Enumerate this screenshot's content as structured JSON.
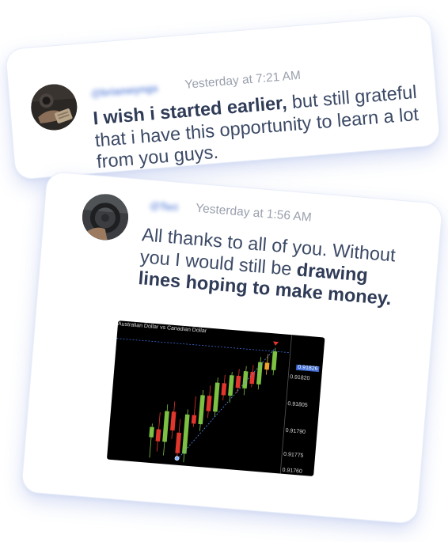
{
  "review1": {
    "username": "@brianwyngs",
    "timestamp": "Yesterday at 7:21 AM",
    "message_bold": "I wish i started earlier,",
    "message_rest": " but still grateful that i have this opportunity to learn a lot from you guys."
  },
  "review2": {
    "username": "@Teri",
    "timestamp": "Yesterday at 1:56 AM",
    "message_plain": "All thanks to all of you. Without you I would still be ",
    "message_bold": "drawing lines hoping to make money."
  },
  "chart_screenshot": {
    "title": "Australian Dollar vs Canadian Dollar",
    "current_price": "0.91826",
    "price_ticks": [
      "0.91820",
      "0.91805",
      "0.91790",
      "0.91775",
      "0.91760"
    ]
  },
  "chart_data": {
    "type": "candlestick",
    "title": "Australian Dollar vs Canadian Dollar",
    "ylim": [
      0.91755,
      0.9183
    ],
    "ticks": [
      0.9182,
      0.91805,
      0.9179,
      0.91775,
      0.9176
    ],
    "current_price": 0.91826,
    "candles": [
      {
        "o": 0.9177,
        "h": 0.91778,
        "l": 0.91758,
        "c": 0.91776,
        "col": "green"
      },
      {
        "o": 0.91775,
        "h": 0.91785,
        "l": 0.91762,
        "c": 0.91768,
        "col": "red"
      },
      {
        "o": 0.91768,
        "h": 0.9179,
        "l": 0.9176,
        "c": 0.91786,
        "col": "green"
      },
      {
        "o": 0.91786,
        "h": 0.91792,
        "l": 0.9177,
        "c": 0.91775,
        "col": "red"
      },
      {
        "o": 0.91774,
        "h": 0.91782,
        "l": 0.91758,
        "c": 0.91762,
        "col": "red"
      },
      {
        "o": 0.91762,
        "h": 0.91788,
        "l": 0.91757,
        "c": 0.91785,
        "col": "green"
      },
      {
        "o": 0.91785,
        "h": 0.91796,
        "l": 0.91778,
        "c": 0.9178,
        "col": "red"
      },
      {
        "o": 0.9178,
        "h": 0.918,
        "l": 0.91776,
        "c": 0.91797,
        "col": "green"
      },
      {
        "o": 0.91797,
        "h": 0.91803,
        "l": 0.91784,
        "c": 0.91788,
        "col": "red"
      },
      {
        "o": 0.91788,
        "h": 0.91808,
        "l": 0.91785,
        "c": 0.91805,
        "col": "green"
      },
      {
        "o": 0.91805,
        "h": 0.9181,
        "l": 0.91795,
        "c": 0.91798,
        "col": "red"
      },
      {
        "o": 0.91798,
        "h": 0.91812,
        "l": 0.91794,
        "c": 0.9181,
        "col": "green"
      },
      {
        "o": 0.9181,
        "h": 0.91814,
        "l": 0.918,
        "c": 0.91803,
        "col": "red"
      },
      {
        "o": 0.91803,
        "h": 0.91816,
        "l": 0.91799,
        "c": 0.91813,
        "col": "green"
      },
      {
        "o": 0.91813,
        "h": 0.91817,
        "l": 0.91804,
        "c": 0.91806,
        "col": "red"
      },
      {
        "o": 0.91806,
        "h": 0.91822,
        "l": 0.91803,
        "c": 0.91819,
        "col": "green"
      },
      {
        "o": 0.91819,
        "h": 0.91824,
        "l": 0.91812,
        "c": 0.91815,
        "col": "orange"
      },
      {
        "o": 0.91815,
        "h": 0.91828,
        "l": 0.91812,
        "c": 0.91826,
        "col": "green"
      }
    ]
  },
  "colors": {
    "accent": "#4f78d6",
    "text": "#3c4a66",
    "muted": "#9aa0ad",
    "card_shadow": "#4d6ed2"
  }
}
